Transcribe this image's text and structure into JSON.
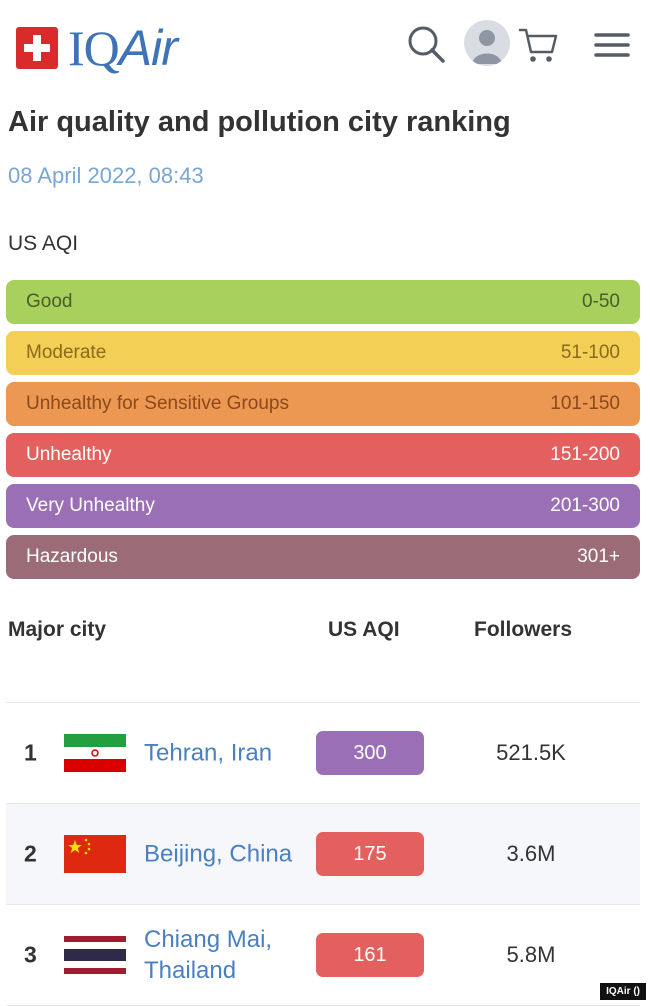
{
  "header": {
    "logo_text_1": "IQ",
    "logo_text_2": "Air",
    "icons": [
      "search-icon",
      "user-avatar-icon",
      "cart-icon",
      "menu-icon"
    ]
  },
  "page": {
    "title": "Air quality and pollution city ranking",
    "timestamp": "08 April 2022, 08:43",
    "aqi_label": "US AQI"
  },
  "legend": [
    {
      "label": "Good",
      "range": "0-50",
      "color": "#a7d05c"
    },
    {
      "label": "Moderate",
      "range": "51-100",
      "color": "#f3cf56"
    },
    {
      "label": "Unhealthy for Sensitive Groups",
      "range": "101-150",
      "color": "#ec9752"
    },
    {
      "label": "Unhealthy",
      "range": "151-200",
      "color": "#e4605f"
    },
    {
      "label": "Very Unhealthy",
      "range": "201-300",
      "color": "#9a6fb5"
    },
    {
      "label": "Hazardous",
      "range": "301+",
      "color": "#9b6b78"
    }
  ],
  "table": {
    "headers": {
      "city": "Major city",
      "aqi": "US AQI",
      "followers": "Followers"
    },
    "rows": [
      {
        "rank": "1",
        "city": "Tehran, Iran",
        "flag": "iran-flag",
        "aqi": "300",
        "aqi_color": "#9a6fb5",
        "followers": "521.5K"
      },
      {
        "rank": "2",
        "city": "Beijing, China",
        "flag": "china-flag",
        "aqi": "175",
        "aqi_color": "#e4605f",
        "followers": "3.6M"
      },
      {
        "rank": "3",
        "city": "Chiang Mai, Thailand",
        "flag": "thailand-flag",
        "aqi": "161",
        "aqi_color": "#e4605f",
        "followers": "5.8M"
      }
    ]
  },
  "watermark": "IQAir ()"
}
